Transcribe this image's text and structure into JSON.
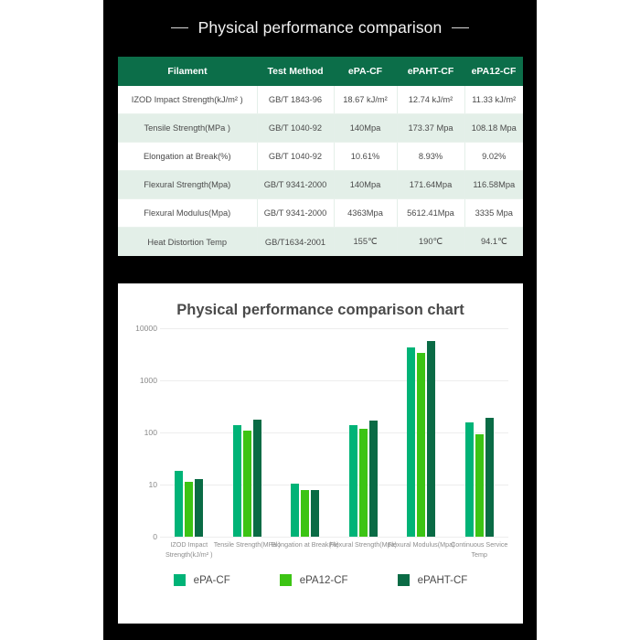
{
  "heading": {
    "title": "Physical performance comparison",
    "left_rule": "—",
    "right_rule": "—"
  },
  "table": {
    "columns": [
      "Filament",
      "Test Method",
      "ePA-CF",
      "ePAHT-CF",
      "ePA12-CF"
    ],
    "rows": [
      [
        "IZOD Impact Strength(kJ/m² )",
        "GB/T 1843-96",
        "18.67 kJ/m²",
        "12.74 kJ/m²",
        "11.33 kJ/m²"
      ],
      [
        "Tensile Strength(MPa )",
        "GB/T 1040-92",
        "140Mpa",
        "173.37 Mpa",
        "108.18 Mpa"
      ],
      [
        "Elongation at Break(%)",
        "GB/T 1040-92",
        "10.61%",
        "8.93%",
        "9.02%"
      ],
      [
        "Flexural Strength(Mpa)",
        "GB/T 9341-2000",
        "140Mpa",
        "171.64Mpa",
        "116.58Mpa"
      ],
      [
        "Flexural Modulus(Mpa)",
        "GB/T 9341-2000",
        "4363Mpa",
        "5612.41Mpa",
        "3335 Mpa"
      ],
      [
        "Heat Distortion Temp",
        "GB/T1634-2001",
        "155℃",
        "190℃",
        "94.1℃"
      ]
    ]
  },
  "chart_data": {
    "type": "bar",
    "title": "Physical performance comparison chart",
    "xlabel": "",
    "ylabel": "",
    "yscale": "log",
    "yticks": [
      0,
      10,
      100,
      1000,
      10000
    ],
    "ytick_labels": [
      "0",
      "10",
      "100",
      "1000",
      "10000"
    ],
    "ylim": [
      0,
      10000
    ],
    "grid": true,
    "legend_position": "bottom",
    "categories": [
      "IZOD Impact Strength(kJ/m² )",
      "Tensile Strength(MPa )",
      "Elongation at Break(%)",
      "Flexural Strength(Mpa)",
      "Flexural Modulus(Mpa)",
      "Continuous Service Temp"
    ],
    "series": [
      {
        "name": "ePA-CF",
        "color": "#00b377",
        "values": [
          18.67,
          140,
          10.61,
          140,
          4363,
          155
        ]
      },
      {
        "name": "ePA12-CF",
        "color": "#3cc414",
        "values": [
          11.33,
          108.18,
          9.02,
          116.58,
          3335,
          94.1
        ]
      },
      {
        "name": "ePAHT-CF",
        "color": "#0a6b45",
        "values": [
          12.74,
          173.37,
          8.93,
          171.64,
          5612.41,
          190
        ]
      }
    ]
  },
  "colors": {
    "panel_background": "#000000",
    "page_background": "#ffffff",
    "table_header": "#0c6e49",
    "table_row_alt": "#e3efe8",
    "series_epa_cf": "#00b377",
    "series_epa12_cf": "#3cc414",
    "series_epaht_cf": "#0a6b45"
  }
}
